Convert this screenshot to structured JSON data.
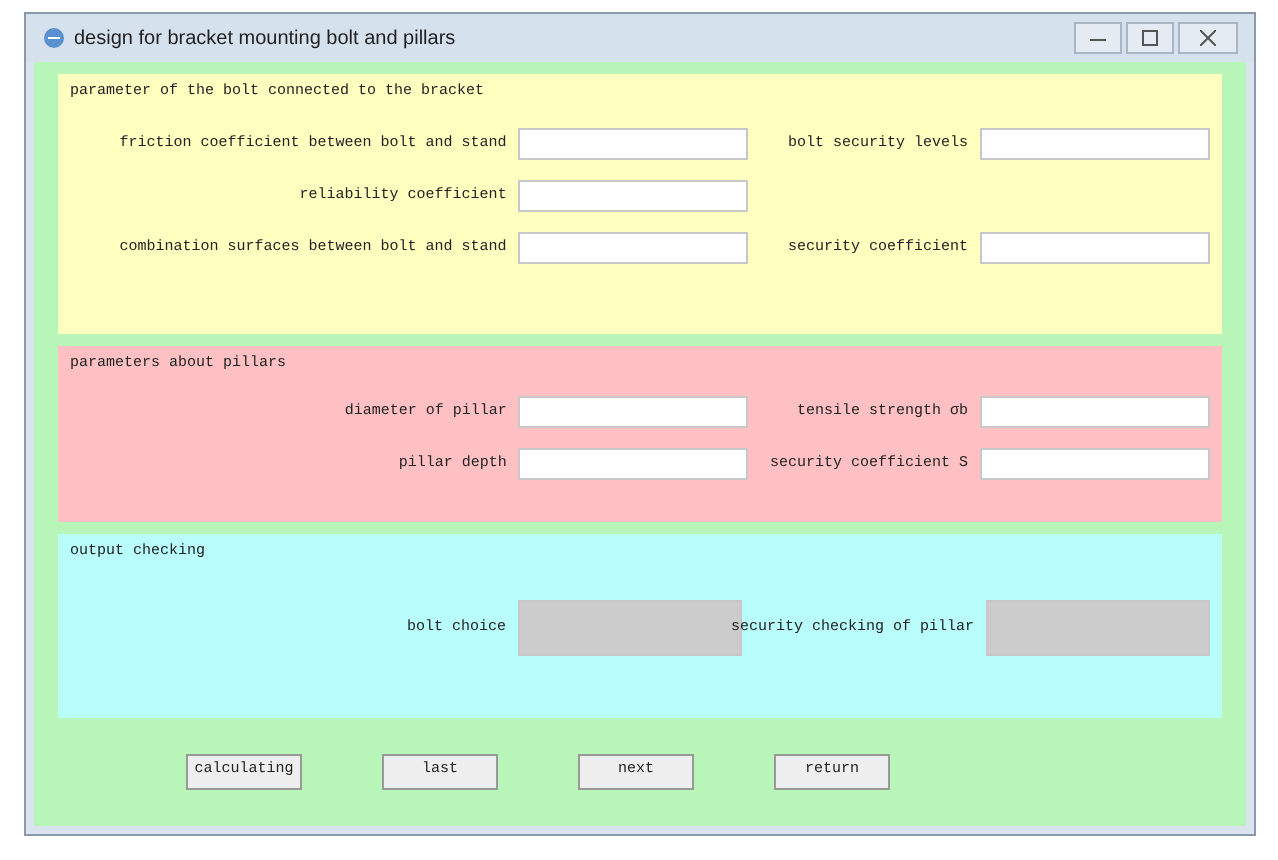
{
  "window": {
    "title": "design for bracket mounting bolt and pillars"
  },
  "panels": [
    {
      "kind": "bolt",
      "title": "parameter of the bolt connected to the bracket",
      "rows": [
        {
          "left": {
            "label": "friction coefficient between bolt and stand"
          },
          "right": {
            "label": "bolt security levels"
          }
        },
        {
          "left": {
            "label": "reliability coefficient"
          }
        },
        {
          "left": {
            "label": "combination surfaces between bolt and stand"
          },
          "right": {
            "label": "security coefficient"
          }
        }
      ]
    },
    {
      "kind": "pillar",
      "title": "parameters about pillars",
      "rows": [
        {
          "left": {
            "label": "diameter of pillar"
          },
          "right": {
            "label": "tensile strength σb"
          }
        },
        {
          "left": {
            "label": "pillar depth"
          },
          "right": {
            "label": "security coefficient S"
          }
        }
      ]
    },
    {
      "kind": "output",
      "title": "output checking",
      "rows": [
        {
          "left": {
            "label": "bolt choice"
          },
          "right": {
            "label": "security checking of pillar"
          }
        }
      ]
    }
  ],
  "buttons": [
    "calculating",
    "last",
    "next",
    "return"
  ]
}
